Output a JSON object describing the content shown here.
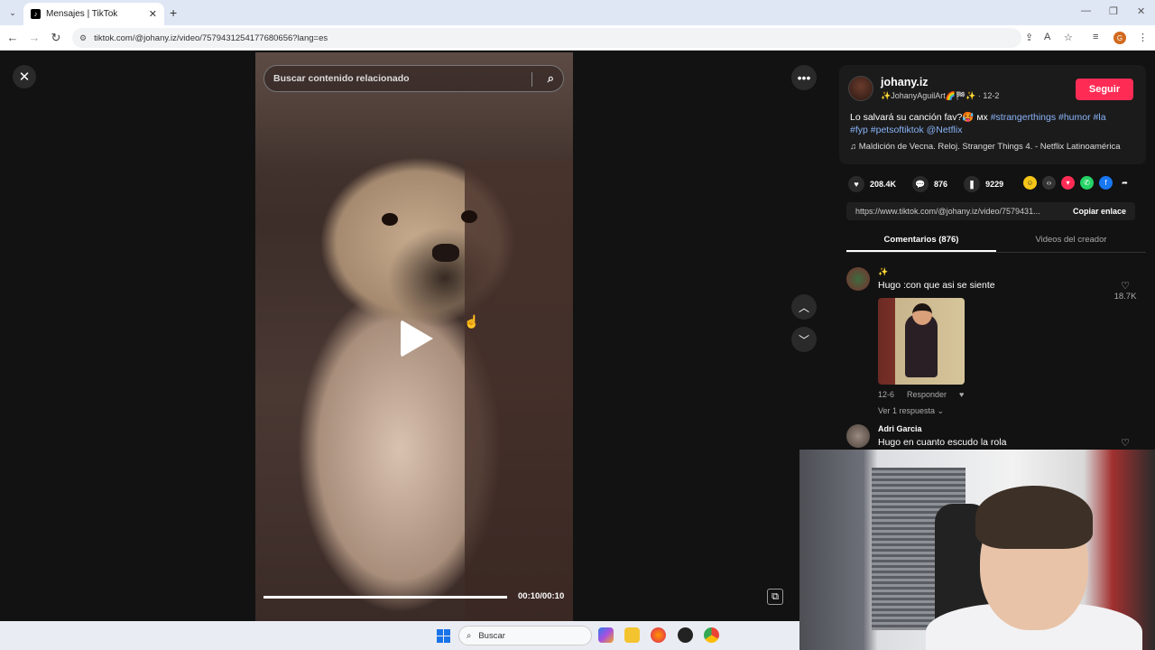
{
  "browser": {
    "tab_title": "Mensajes | TikTok",
    "url": "tiktok.com/@johany.iz/video/7579431254177680656?lang=es",
    "profile_initial": "G"
  },
  "video": {
    "search_placeholder": "Buscar contenido relacionado",
    "time": "00:10/00:10",
    "progress": 1.0
  },
  "author": {
    "name": "johany.iz",
    "subtitle": "✨JohanyAguilArt🌈🏁✨ · 12-2",
    "follow_label": "Seguir"
  },
  "description": {
    "text": "Lo salvará su canción fav?🥵 ᴍx ",
    "tags_line1": "#strangerthings #humor #la",
    "tags_line2": "#fyp #petsoftiktok @Netflix"
  },
  "music": "♫  Maldición de Vecna. Reloj. Stranger Things 4. - Netflix Latinoamérica",
  "stats": {
    "likes": "208.4K",
    "comments": "876",
    "saves": "9229"
  },
  "share": {
    "url": "https://www.tiktok.com/@johany.iz/video/7579431...",
    "copy_label": "Copiar enlace"
  },
  "tabs": {
    "comments": "Comentarios (876)",
    "creator_videos": "Videos del creador"
  },
  "comments": [
    {
      "user": "✨",
      "text": "Hugo :con que asi se siente",
      "likes": "18.7K",
      "date": "12-6",
      "reply_label": "Responder",
      "replies": "Ver 1 respuesta ⌄"
    },
    {
      "user": "Adri Garcia",
      "text": "Hugo en cuanto escudo la rola",
      "likes": ""
    }
  ],
  "taskbar": {
    "search_label": "Buscar"
  },
  "colors": {
    "follow_button": "#fe2c55",
    "link": "#8ab4f8"
  }
}
